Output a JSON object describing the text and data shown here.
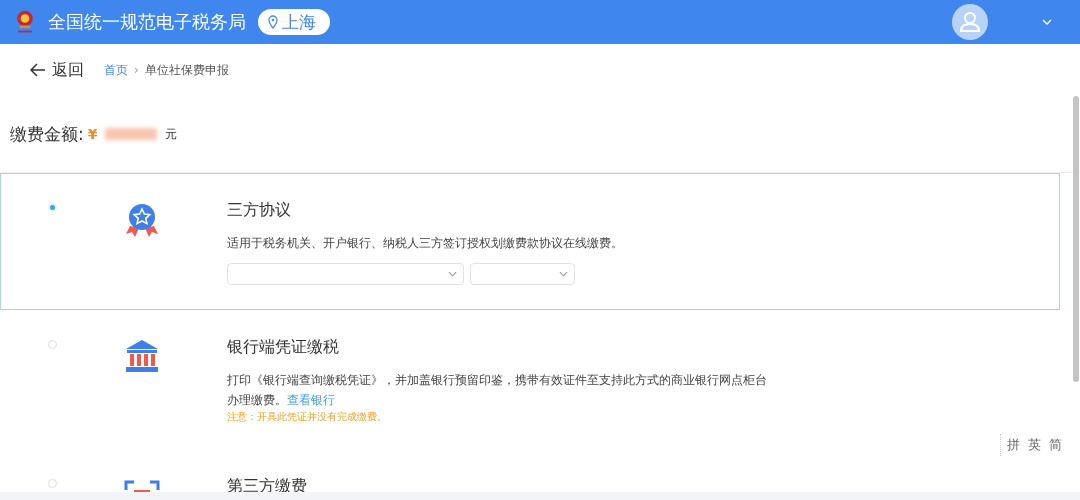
{
  "header": {
    "title": "全国统一规范电子税务局",
    "location": "上海"
  },
  "nav": {
    "back": "返回",
    "separator": "›",
    "breadcrumb": [
      {
        "label": "首页",
        "kind": "link"
      },
      {
        "label": "单位社保费申报",
        "kind": "current"
      }
    ]
  },
  "amount": {
    "label": "缴费金额:",
    "currency": "¥",
    "unit": "元"
  },
  "options": [
    {
      "kind": "medal",
      "selected": true,
      "title": "三方协议",
      "description": "适用于税务机关、开户银行、纳税人三方签订授权划缴费款协议在线缴费。",
      "dropdowns": [
        {
          "kind": "wide"
        },
        {
          "kind": "narrow"
        }
      ]
    },
    {
      "kind": "bank",
      "selected": false,
      "title": "银行端凭证缴税",
      "description": "打印《银行端查询缴税凭证》，并加盖银行预留印鉴，携带有效证件至支持此方式的商业银行网点柜台办理缴费。",
      "link": "查看银行",
      "note": "注意：开具此凭证并没有完成缴费。"
    },
    {
      "kind": "scan",
      "selected": false,
      "title": "第三方缴费"
    }
  ],
  "ime_toolbar": [
    "拼",
    "英",
    "简"
  ]
}
